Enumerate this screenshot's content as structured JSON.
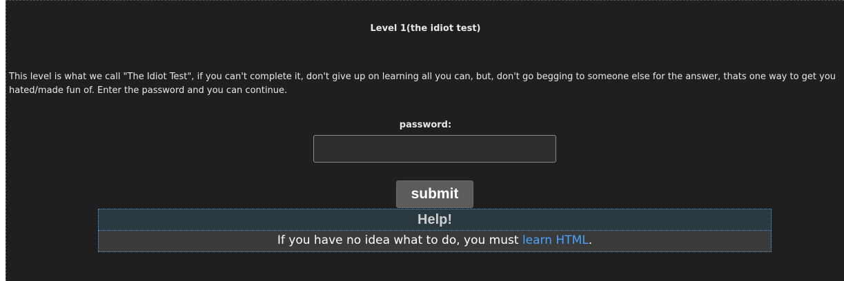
{
  "level": {
    "title": "Level 1(the idiot test)",
    "intro": "This level is what we call \"The Idiot Test\", if you can't complete it, don't give up on learning all you can, but, don't go begging to someone else for the answer, thats one way to get you hated/made fun of. Enter the password and you can continue."
  },
  "form": {
    "password_label": "password:",
    "password_value": "",
    "submit_label": "submit"
  },
  "help": {
    "heading": "Help!",
    "text_before": "If you have no idea what to do, you must ",
    "link_text": "learn HTML",
    "text_after": "."
  },
  "colors": {
    "background": "#1f1f1f",
    "link": "#4aa3ff",
    "help_border": "#4fa3e0"
  }
}
